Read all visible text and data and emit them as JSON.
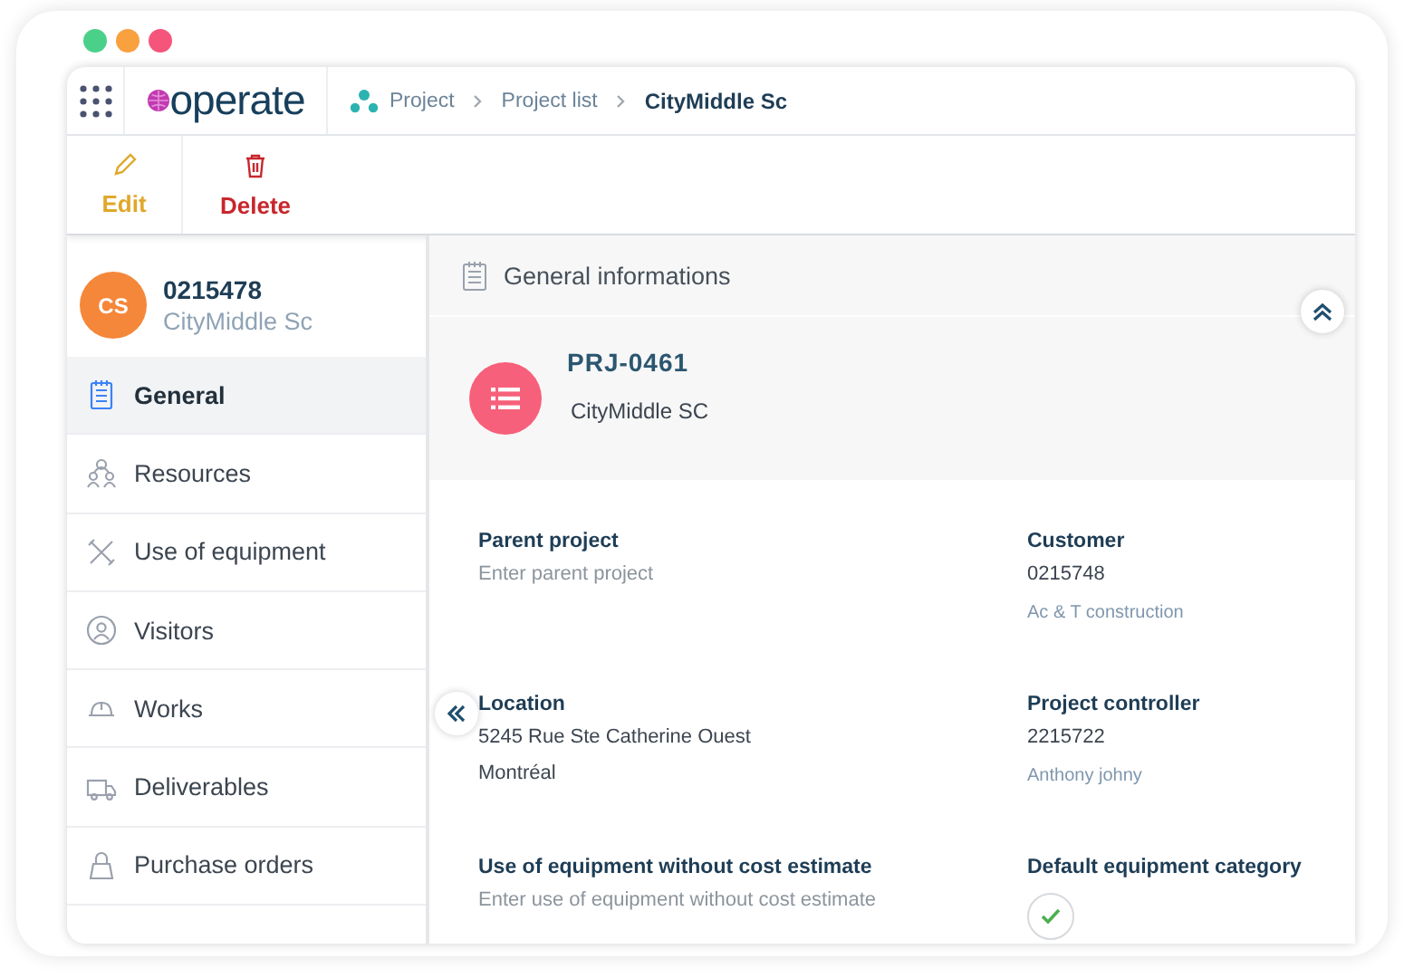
{
  "header": {
    "logo": "operate",
    "breadcrumbs": [
      {
        "label": "Project",
        "current": false
      },
      {
        "label": "Project list",
        "current": false
      },
      {
        "label": "CityMiddle Sc",
        "current": true
      }
    ]
  },
  "toolbar": [
    {
      "label": "Edit",
      "kind": "edit"
    },
    {
      "label": "Delete",
      "kind": "delete"
    }
  ],
  "sidebar": {
    "avatar": "CS",
    "code": "0215478",
    "name": "CityMiddle Sc",
    "items": [
      {
        "label": "General",
        "selected": true
      },
      {
        "label": "Resources",
        "selected": false
      },
      {
        "label": "Use of equipment",
        "selected": false
      },
      {
        "label": "Visitors",
        "selected": false
      },
      {
        "label": "Works",
        "selected": false
      },
      {
        "label": "Deliverables",
        "selected": false
      },
      {
        "label": "Purchase orders",
        "selected": false
      }
    ]
  },
  "section": {
    "title": "General informations",
    "project_code": "PRJ-0461",
    "project_name": "CityMiddle SC"
  },
  "fields": [
    {
      "label": "Parent project",
      "kind": "input",
      "placeholder": "Enter parent project"
    },
    {
      "label": "Customer",
      "kind": "text",
      "lines": [
        "0215748"
      ],
      "sub": "Ac & T construction"
    },
    {
      "label": "Location",
      "kind": "text",
      "lines": [
        "5245 Rue Ste Catherine Ouest",
        "Montréal"
      ]
    },
    {
      "label": "Project controller",
      "kind": "text",
      "lines": [
        "2215722"
      ],
      "sub": "Anthony johny"
    },
    {
      "label": "Use of equipment without cost estimate",
      "kind": "input",
      "placeholder": "Enter use of equipment without cost estimate"
    },
    {
      "label": "Default equipment category",
      "kind": "check",
      "checked": true
    }
  ]
}
